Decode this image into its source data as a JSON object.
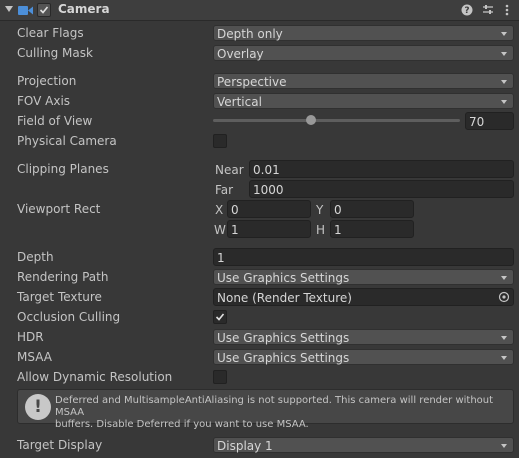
{
  "header": {
    "title": "Camera",
    "enabled": true
  },
  "rows": {
    "clear_flags": {
      "label": "Clear Flags",
      "value": "Depth only"
    },
    "culling_mask": {
      "label": "Culling Mask",
      "value": "Overlay"
    },
    "projection": {
      "label": "Projection",
      "value": "Perspective"
    },
    "fov_axis": {
      "label": "FOV Axis",
      "value": "Vertical"
    },
    "field_of_view": {
      "label": "Field of View",
      "value": "70"
    },
    "physical_camera": {
      "label": "Physical Camera",
      "checked": false
    },
    "clipping_planes": {
      "label": "Clipping Planes",
      "near_label": "Near",
      "near": "0.01",
      "far_label": "Far",
      "far": "1000"
    },
    "viewport_rect": {
      "label": "Viewport Rect",
      "x_label": "X",
      "x": "0",
      "y_label": "Y",
      "y": "0",
      "w_label": "W",
      "w": "1",
      "h_label": "H",
      "h": "1"
    },
    "depth": {
      "label": "Depth",
      "value": "1"
    },
    "rendering_path": {
      "label": "Rendering Path",
      "value": "Use Graphics Settings"
    },
    "target_texture": {
      "label": "Target Texture",
      "value": "None (Render Texture)"
    },
    "occlusion_culling": {
      "label": "Occlusion Culling",
      "checked": true
    },
    "hdr": {
      "label": "HDR",
      "value": "Use Graphics Settings"
    },
    "msaa": {
      "label": "MSAA",
      "value": "Use Graphics Settings"
    },
    "allow_dynamic_resolution": {
      "label": "Allow Dynamic Resolution",
      "checked": false
    },
    "target_display": {
      "label": "Target Display",
      "value": "Display 1"
    }
  },
  "help": {
    "line1": "Deferred and MultisampleAntiAliasing is not supported. This camera will render without MSAA",
    "line2": "buffers. Disable Deferred if you want to use MSAA."
  },
  "colors": {
    "accent": "#4c8fd9",
    "background": "#383838",
    "dropdown": "#515151",
    "field": "#2a2a2a"
  }
}
